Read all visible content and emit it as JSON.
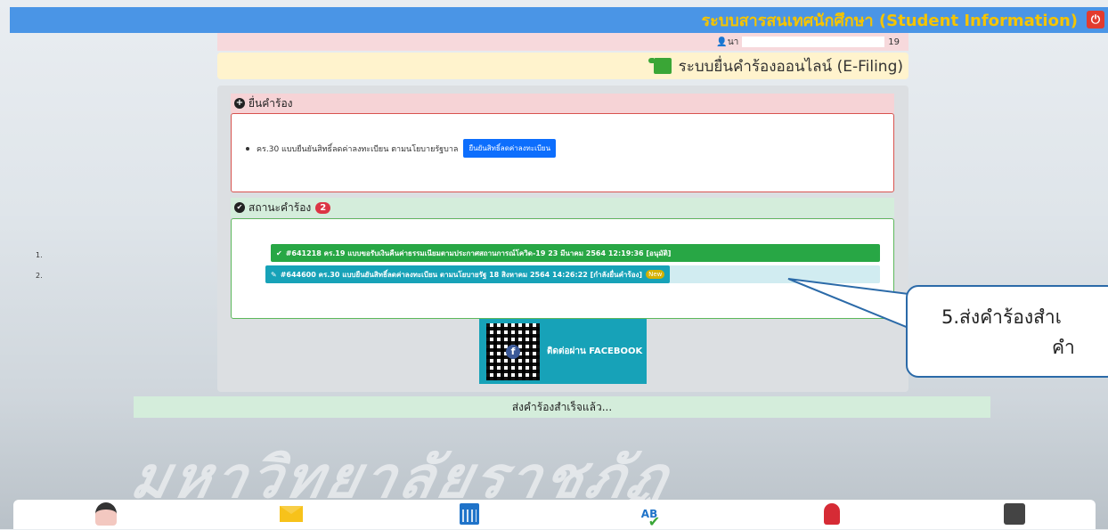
{
  "header": {
    "title": "ระบบสารสนเทศนักศึกษา (Student Information)",
    "logout_icon": "logout-icon"
  },
  "userbar": {
    "prefix": "นา",
    "suffix": "19"
  },
  "filing": {
    "title": "ระบบยื่นคำร้องออนไลน์ (E-Filing)"
  },
  "submit_section": {
    "heading": "ยื่นคำร้อง",
    "item": "คร.30 แบบยืนยันสิทธิ์ลดค่าลงทะเบียน ตามนโยบายรัฐบาล",
    "button": "ยืนยันสิทธิ์ลดค่าลงทะเบียน"
  },
  "status_section": {
    "heading": "สถานะคำร้อง",
    "count": "2",
    "requests": [
      {
        "num": "1.",
        "text": "#641218 คร.19 แบบขอรับเงินคืนค่าธรรมเนียมตามประกาศสถานการณ์โควิด-19 23 มีนาคม 2564 12:19:36 [อนุมัติ]"
      },
      {
        "num": "2.",
        "text": "#644600 คร.30 แบบยืนยันสิทธิ์ลดค่าลงทะเบียน ตามนโยบายรัฐ 18 สิงหาคม 2564 14:26:22 [กำลังยื่นคำร้อง]",
        "badge": "New"
      }
    ]
  },
  "facebook": {
    "label": "ติดต่อผ่าน FACEBOOK"
  },
  "success": {
    "message": "ส่งคำร้องสำเร็จแล้ว..."
  },
  "callout": {
    "line1": "5.ส่งคำร้องสำเ",
    "line2": "คำ"
  },
  "watermark": "มหาวิทยาลัยราชภัฏ",
  "colors": {
    "topbar": "#4a95e6",
    "title": "#f5c400",
    "success_row": "#28a745",
    "pending_row": "#17a2b8",
    "button": "#0d6efd"
  }
}
